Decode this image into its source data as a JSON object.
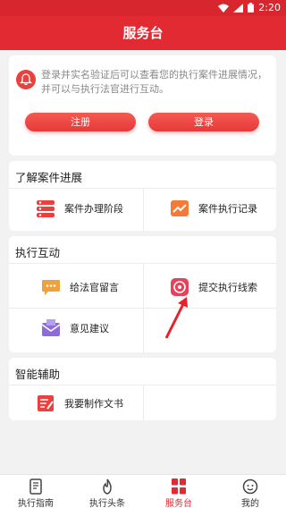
{
  "status_bar": {
    "time": "2:20"
  },
  "header": {
    "title": "服务台"
  },
  "notice": {
    "text": "登录并实名验证后可以查看您的执行案件进展情况，并可以与执行法官进行互动。",
    "register_label": "注册",
    "login_label": "登录"
  },
  "progress_section": {
    "title": "了解案件进展",
    "items": [
      {
        "label": "案件办理阶段",
        "icon": "list-stages-icon"
      },
      {
        "label": "案件执行记录",
        "icon": "trend-chart-icon"
      }
    ]
  },
  "interaction_section": {
    "title": "执行互动",
    "items": [
      {
        "label": "给法官留言",
        "icon": "chat-bubble-icon"
      },
      {
        "label": "提交执行线索",
        "icon": "clue-disc-icon"
      },
      {
        "label": "意见建议",
        "icon": "envelope-icon"
      }
    ]
  },
  "assist_section": {
    "title": "智能辅助",
    "items": [
      {
        "label": "我要制作文书",
        "icon": "document-icon"
      }
    ]
  },
  "tab_bar": {
    "tabs": [
      {
        "label": "执行指南",
        "icon": "guide-book-icon"
      },
      {
        "label": "执行头条",
        "icon": "flame-icon"
      },
      {
        "label": "服务台",
        "icon": "grid-icon"
      },
      {
        "label": "我的",
        "icon": "user-face-icon"
      }
    ],
    "active_index": 2
  },
  "colors": {
    "brand_red": "#e22a32",
    "accent_orange": "#f0a03c",
    "accent_purple": "#8c6cdc"
  }
}
